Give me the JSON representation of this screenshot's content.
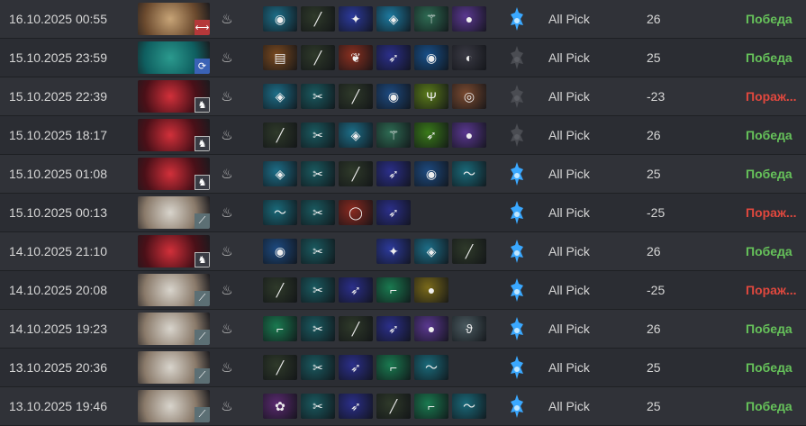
{
  "matches": [
    {
      "date": "16.10.2025 00:55",
      "hero": "engineer-goggles-hero",
      "heroColors": [
        "#6b4a2e",
        "#c7a477"
      ],
      "badge": "str",
      "badgeGlyph": "⟷",
      "lane": "fire-hand-icon",
      "items": [
        [
          "#1d6e88",
          "orb-icon",
          "◉"
        ],
        [
          "#2f3a2a",
          "staff-icon",
          "╱"
        ],
        [
          "#2c3a9c",
          "cloak-icon",
          "✦"
        ],
        [
          "#1d7aa0",
          "lens-icon",
          "◈"
        ],
        [
          "#2e6b53",
          "wand-icon",
          "⚚"
        ],
        [
          "#5a3890",
          "pouch-icon",
          "●"
        ]
      ],
      "tower": "blue",
      "mode": "All Pick",
      "score": "26",
      "result": "Победа",
      "win": true
    },
    {
      "date": "15.10.2025 23:59",
      "hero": "teal-assassin-hero",
      "heroColors": [
        "#0f5f60",
        "#2b9a8e"
      ],
      "badge": "int",
      "badgeGlyph": "⟳",
      "lane": "fire-hand-icon",
      "items": [
        [
          "#7a4a20",
          "scroll-icon",
          "▤"
        ],
        [
          "#2f3a2a",
          "staff-icon",
          "╱"
        ],
        [
          "#8a3020",
          "charm-icon",
          "❦"
        ],
        [
          "#2b2f8a",
          "blade-icon",
          "➶"
        ],
        [
          "#18508a",
          "lens-icon",
          "◉"
        ],
        [
          "#3a3a44",
          "mask-icon",
          "◐"
        ]
      ],
      "tower": "gray",
      "mode": "All Pick",
      "score": "25",
      "result": "Победа",
      "win": true
    },
    {
      "date": "15.10.2025 22:39",
      "hero": "red-demon-hero",
      "heroColors": [
        "#4a1018",
        "#d2303a"
      ],
      "badge": "agi",
      "badgeGlyph": "♞",
      "lane": "fire-hand-icon",
      "items": [
        [
          "#1d6e88",
          "lens-icon",
          "◈"
        ],
        [
          "#1a5a60",
          "axe-icon",
          "✂"
        ],
        [
          "#2f3a2a",
          "staff-icon",
          "╱"
        ],
        [
          "#1d4a80",
          "orb-icon",
          "◉"
        ],
        [
          "#5a7a1a",
          "trident-icon",
          "Ψ"
        ],
        [
          "#7a4a30",
          "shield-icon",
          "◎"
        ]
      ],
      "tower": "gray",
      "mode": "All Pick",
      "score": "-23",
      "result": "Пораж...",
      "win": false
    },
    {
      "date": "15.10.2025 18:17",
      "hero": "red-demon-hero",
      "heroColors": [
        "#4a1018",
        "#d2303a"
      ],
      "badge": "agi",
      "badgeGlyph": "♞",
      "lane": "fire-hand-icon",
      "items": [
        [
          "#2f3a2a",
          "staff-icon",
          "╱"
        ],
        [
          "#1a5a60",
          "axe-icon",
          "✂"
        ],
        [
          "#1d6e88",
          "lens-icon",
          "◈"
        ],
        [
          "#2e6b53",
          "wand-icon",
          "⚚"
        ],
        [
          "#3a7a1a",
          "blade-icon",
          "➶"
        ],
        [
          "#5a3890",
          "pouch-icon",
          "●"
        ]
      ],
      "tower": "gray",
      "mode": "All Pick",
      "score": "26",
      "result": "Победа",
      "win": true
    },
    {
      "date": "15.10.2025 01:08",
      "hero": "red-demon-hero",
      "heroColors": [
        "#4a1018",
        "#d2303a"
      ],
      "badge": "agi",
      "badgeGlyph": "♞",
      "lane": "fire-hand-icon",
      "items": [
        [
          "#1d6e88",
          "lens-icon",
          "◈"
        ],
        [
          "#1a5a60",
          "axe-icon",
          "✂"
        ],
        [
          "#2f3a2a",
          "staff-icon",
          "╱"
        ],
        [
          "#2b2f8a",
          "blade-icon",
          "➶"
        ],
        [
          "#1d4a80",
          "orb-icon",
          "◉"
        ],
        [
          "#1a6a7a",
          "wave-icon",
          "〜"
        ]
      ],
      "tower": "blue",
      "mode": "All Pick",
      "score": "25",
      "result": "Победа",
      "win": true
    },
    {
      "date": "15.10.2025 00:13",
      "hero": "tusk-warrior-hero",
      "heroColors": [
        "#8a7a6a",
        "#d8d4cc"
      ],
      "badge": "agi2",
      "badgeGlyph": "⟋",
      "lane": "fire-hand-icon",
      "items": [
        [
          "#1a6a7a",
          "wave-icon",
          "〜"
        ],
        [
          "#1a5a60",
          "axe-icon",
          "✂"
        ],
        [
          "#8a2a20",
          "ring-icon",
          "◯"
        ],
        [
          "#2b2f8a",
          "blade-icon",
          "➶"
        ],
        null,
        null
      ],
      "tower": "blue",
      "mode": "All Pick",
      "score": "-25",
      "result": "Пораж...",
      "win": false
    },
    {
      "date": "14.10.2025 21:10",
      "hero": "red-demon-hero",
      "heroColors": [
        "#4a1018",
        "#d2303a"
      ],
      "badge": "agi",
      "badgeGlyph": "♞",
      "lane": "fire-hand-icon",
      "items": [
        [
          "#1d4a80",
          "orb-icon",
          "◉"
        ],
        [
          "#1a5a60",
          "axe-icon",
          "✂"
        ],
        null,
        [
          "#2c3a9c",
          "cloak-icon",
          "✦"
        ],
        [
          "#1d6e88",
          "lens-icon",
          "◈"
        ],
        [
          "#2f3a2a",
          "staff-icon",
          "╱"
        ]
      ],
      "tower": "blue",
      "mode": "All Pick",
      "score": "26",
      "result": "Победа",
      "win": true
    },
    {
      "date": "14.10.2025 20:08",
      "hero": "tusk-warrior-hero",
      "heroColors": [
        "#8a7a6a",
        "#d8d4cc"
      ],
      "badge": "agi2",
      "badgeGlyph": "⟋",
      "lane": "fire-hand-icon",
      "items": [
        [
          "#2f3a2a",
          "staff-icon",
          "╱"
        ],
        [
          "#1a5a60",
          "axe-icon",
          "✂"
        ],
        [
          "#2b2f8a",
          "blade-icon",
          "➶"
        ],
        [
          "#1a7a50",
          "boots-icon",
          "⌐"
        ],
        [
          "#7a6a1a",
          "gourd-icon",
          "●"
        ],
        null
      ],
      "tower": "blue",
      "mode": "All Pick",
      "score": "-25",
      "result": "Пораж...",
      "win": false
    },
    {
      "date": "14.10.2025 19:23",
      "hero": "tusk-warrior-hero",
      "heroColors": [
        "#8a7a6a",
        "#d8d4cc"
      ],
      "badge": "agi2",
      "badgeGlyph": "⟋",
      "lane": "fire-hand-icon",
      "items": [
        [
          "#1a7a50",
          "boots-icon",
          "⌐"
        ],
        [
          "#1a5a60",
          "axe-icon",
          "✂"
        ],
        [
          "#2f3a2a",
          "staff-icon",
          "╱"
        ],
        [
          "#2b2f8a",
          "blade-icon",
          "➶"
        ],
        [
          "#5a3890",
          "pouch-icon",
          "●"
        ],
        [
          "#4a5a60",
          "swirl-icon",
          "ϑ"
        ]
      ],
      "tower": "blue",
      "mode": "All Pick",
      "score": "26",
      "result": "Победа",
      "win": true
    },
    {
      "date": "13.10.2025 20:36",
      "hero": "tusk-warrior-hero",
      "heroColors": [
        "#8a7a6a",
        "#d8d4cc"
      ],
      "badge": "agi2",
      "badgeGlyph": "⟋",
      "lane": "fire-hand-icon",
      "items": [
        [
          "#2f3a2a",
          "staff-icon",
          "╱"
        ],
        [
          "#1a5a60",
          "axe-icon",
          "✂"
        ],
        [
          "#2b2f8a",
          "blade-icon",
          "➶"
        ],
        [
          "#1a7a50",
          "boots-icon",
          "⌐"
        ],
        [
          "#1a6a7a",
          "wave-icon",
          "〜"
        ],
        null
      ],
      "tower": "blue",
      "mode": "All Pick",
      "score": "25",
      "result": "Победа",
      "win": true
    },
    {
      "date": "13.10.2025 19:46",
      "hero": "tusk-warrior-hero",
      "heroColors": [
        "#8a7a6a",
        "#d8d4cc"
      ],
      "badge": "agi2",
      "badgeGlyph": "⟋",
      "lane": "fire-hand-icon",
      "items": [
        [
          "#5a2a70",
          "flower-icon",
          "✿"
        ],
        [
          "#1a5a60",
          "axe-icon",
          "✂"
        ],
        [
          "#2b2f8a",
          "blade-icon",
          "➶"
        ],
        [
          "#2f3a2a",
          "staff-icon",
          "╱"
        ],
        [
          "#1a7a50",
          "boots-icon",
          "⌐"
        ],
        [
          "#1a6a7a",
          "wave-icon",
          "〜"
        ]
      ],
      "tower": "blue",
      "mode": "All Pick",
      "score": "25",
      "result": "Победа",
      "win": true
    }
  ],
  "colors": {
    "win": "#66c25a",
    "loss": "#e0483e",
    "towerBlue": "#3aa8ff",
    "towerGray": "#4a4c52"
  }
}
